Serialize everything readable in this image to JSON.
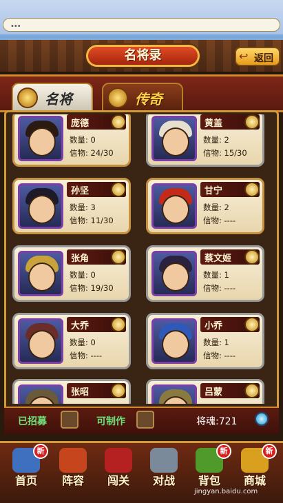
{
  "chat": {
    "dots": "•••"
  },
  "header": {
    "title": "名将录",
    "back_label": "返回"
  },
  "tabs": [
    {
      "label": "名将",
      "active": true
    },
    {
      "label": "传奇",
      "active": false
    }
  ],
  "generals": [
    {
      "name": "庞德",
      "qty_label": "数量",
      "qty": "0",
      "token_label": "信物",
      "token": "24/30",
      "hair": "#2a1a12"
    },
    {
      "name": "黄盖",
      "qty_label": "数量",
      "qty": "2",
      "token_label": "信物",
      "token": "15/30",
      "hair": "#e8e0cf"
    },
    {
      "name": "孙坚",
      "qty_label": "数量",
      "qty": "3",
      "token_label": "信物",
      "token": "11/30",
      "hair": "#1e1a2a"
    },
    {
      "name": "甘宁",
      "qty_label": "数量",
      "qty": "2",
      "token_label": "信物",
      "token": "----",
      "hair": "#c32a1a"
    },
    {
      "name": "张角",
      "qty_label": "数量",
      "qty": "0",
      "token_label": "信物",
      "token": "19/30",
      "hair": "#c9a33a"
    },
    {
      "name": "蔡文姬",
      "qty_label": "数量",
      "qty": "1",
      "token_label": "信物",
      "token": "----",
      "hair": "#2b2240"
    },
    {
      "name": "大乔",
      "qty_label": "数量",
      "qty": "0",
      "token_label": "信物",
      "token": "----",
      "hair": "#6a2d2a"
    },
    {
      "name": "小乔",
      "qty_label": "数量",
      "qty": "1",
      "token_label": "信物",
      "token": "----",
      "hair": "#2f59b8"
    },
    {
      "name": "张昭",
      "hair": "#6b5a3a"
    },
    {
      "name": "吕蒙",
      "hair": "#8a7a40"
    }
  ],
  "status": {
    "recruited_label": "已招募",
    "craftable_label": "可制作",
    "soul_text": "将魂:721"
  },
  "nav": [
    {
      "label": "首页",
      "badge": "新",
      "color": "#3f6fbf"
    },
    {
      "label": "阵容",
      "badge": "",
      "color": "#c7451c"
    },
    {
      "label": "闯关",
      "badge": "",
      "color": "#b52020"
    },
    {
      "label": "对战",
      "badge": "",
      "color": "#7a8a9a"
    },
    {
      "label": "背包",
      "badge": "新",
      "color": "#4f9a2a"
    },
    {
      "label": "商城",
      "badge": "新",
      "color": "#d9a020"
    }
  ],
  "watermark": "jingyan.baidu.com"
}
